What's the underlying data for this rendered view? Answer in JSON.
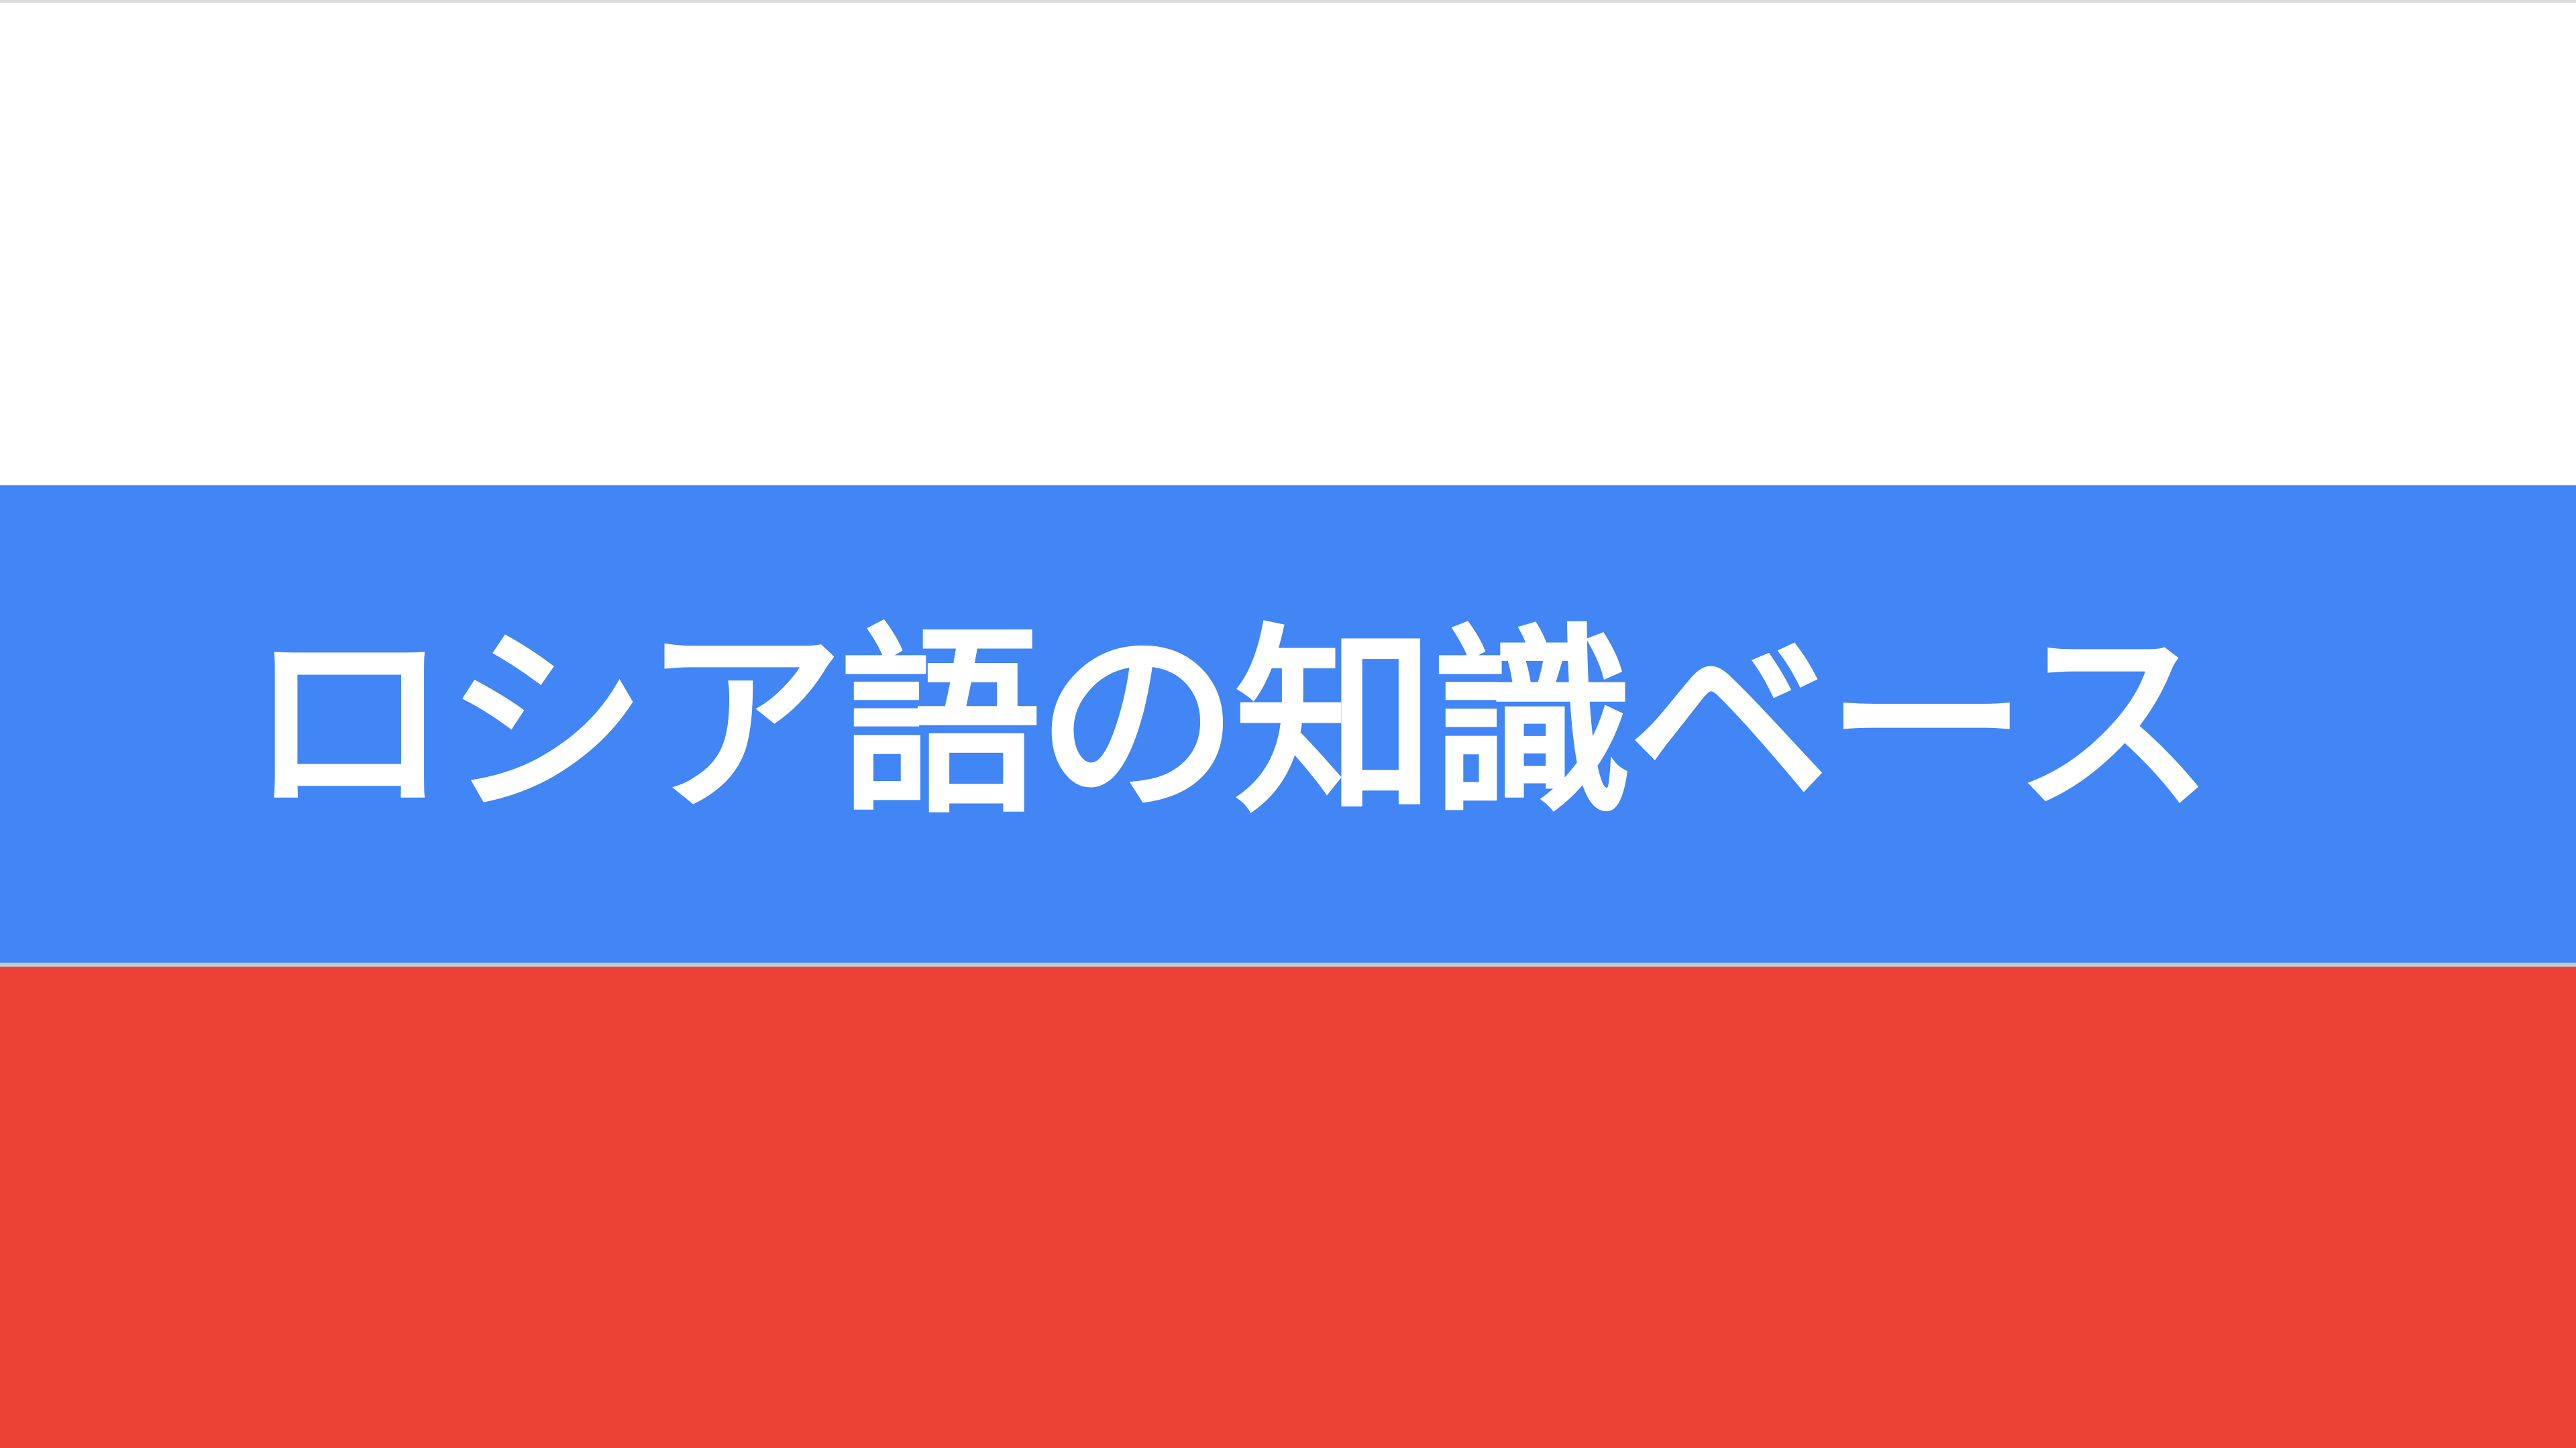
{
  "title": "ロシア語の知識ベース",
  "colors": {
    "top": "#ffffff",
    "middle": "#4285f4",
    "bottom": "#ea4335",
    "text": "#ffffff"
  }
}
